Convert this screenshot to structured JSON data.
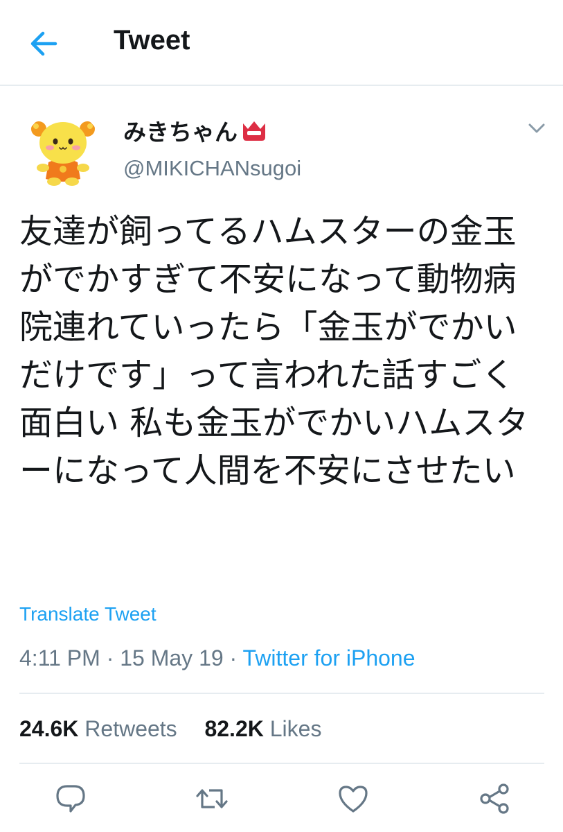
{
  "header": {
    "title": "Tweet",
    "back_icon": "back-arrow-icon",
    "accent_color": "#1da1f2"
  },
  "tweet": {
    "author": {
      "display_name": "みきちゃん",
      "badge_icon": "red-crown-emoji-icon",
      "handle": "@MIKICHANsugoi",
      "avatar": "yellow-mascot-avatar"
    },
    "menu_icon": "chevron-down-icon",
    "text": "友達が飼ってるハムスターの金玉がでかすぎて不安になって動物病院連れていったら「金玉がでかいだけです」って言われた話すごく面白い 私も金玉がでかいハムスターになって人間を不安にさせたい",
    "translate_label": "Translate Tweet",
    "time": "4:11 PM",
    "date": "15 May 19",
    "separator": " · ",
    "source": "Twitter for iPhone"
  },
  "stats": {
    "retweets_count": "24.6K",
    "retweets_label": "Retweets",
    "likes_count": "82.2K",
    "likes_label": "Likes"
  },
  "actions": {
    "reply_icon": "reply-icon",
    "retweet_icon": "retweet-icon",
    "like_icon": "heart-icon",
    "share_icon": "share-icon",
    "icon_color": "#657786"
  }
}
